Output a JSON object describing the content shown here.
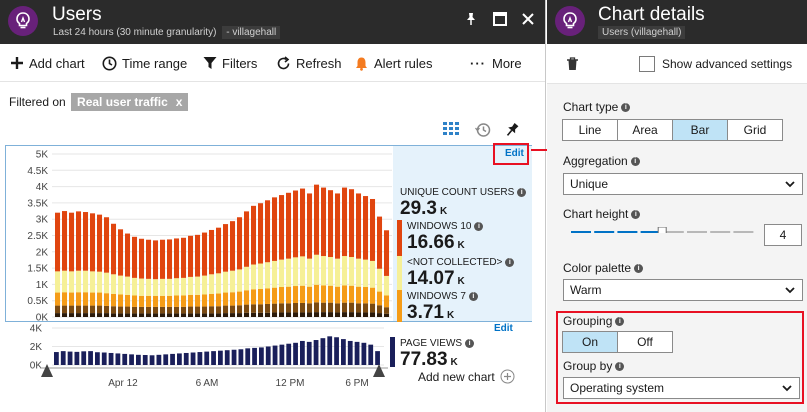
{
  "left_blade": {
    "title": "Users",
    "subtitle": "Last 24 hours (30 minute granularity)",
    "resource": "villagehall"
  },
  "toolbar": {
    "add_chart": "Add chart",
    "time_range": "Time range",
    "filters": "Filters",
    "refresh": "Refresh",
    "alert_rules": "Alert rules",
    "more": "More"
  },
  "filter": {
    "prefix": "Filtered on",
    "chip": "Real user traffic",
    "chip_close": "x"
  },
  "edit_label": "Edit",
  "main_chart_legend": {
    "total_label": "UNIQUE COUNT USERS",
    "total_value": "29.3",
    "total_unit": "K",
    "items": [
      {
        "label": "WINDOWS 10",
        "value": "16.66",
        "unit": "K",
        "color": "#e0450f"
      },
      {
        "label": "<NOT COLLECTED>",
        "value": "14.07",
        "unit": "K",
        "color": "#f6f097"
      },
      {
        "label": "WINDOWS 7",
        "value": "3.71",
        "unit": "K",
        "color": "#f59c17"
      }
    ]
  },
  "mini_chart_legend": {
    "label": "PAGE VIEWS",
    "value": "77.83",
    "unit": "K",
    "color": "#1a1f5a"
  },
  "add_new_chart": "Add new chart",
  "chart_data": [
    {
      "type": "bar",
      "stacked": true,
      "title": "",
      "ylim": [
        0,
        5000
      ],
      "y_tick_labels": [
        "5K",
        "4.5K",
        "4K",
        "3.5K",
        "3K",
        "2.5K",
        "2K",
        "1.5K",
        "1K",
        "0.5K",
        "0K"
      ],
      "series_order_bottom_to_top": [
        "dark base",
        "brown",
        "orange",
        "<NOT COLLECTED>",
        "WINDOWS 10"
      ],
      "series": [
        {
          "name": "WINDOWS 10",
          "color": "#e0450f",
          "values": [
            1800,
            1830,
            1800,
            1820,
            1800,
            1780,
            1750,
            1700,
            1550,
            1420,
            1320,
            1260,
            1220,
            1200,
            1190,
            1200,
            1210,
            1220,
            1230,
            1260,
            1280,
            1320,
            1360,
            1400,
            1460,
            1520,
            1600,
            1700,
            1800,
            1850,
            1900,
            1950,
            1980,
            2020,
            2050,
            2080,
            2000,
            2150,
            2100,
            2050,
            2000,
            2100,
            2080,
            2000,
            1950,
            1900,
            1600,
            1400
          ]
        },
        {
          "name": "<NOT COLLECTED>",
          "color": "#f6f097",
          "values": [
            650,
            660,
            650,
            660,
            660,
            650,
            640,
            630,
            600,
            580,
            560,
            540,
            530,
            520,
            510,
            520,
            520,
            530,
            540,
            550,
            560,
            580,
            600,
            620,
            640,
            660,
            680,
            720,
            760,
            780,
            800,
            820,
            840,
            860,
            880,
            900,
            860,
            920,
            900,
            880,
            860,
            900,
            880,
            860,
            840,
            820,
            700,
            600
          ]
        },
        {
          "name": "orange",
          "color": "#f59c17",
          "values": [
            400,
            410,
            400,
            410,
            410,
            400,
            400,
            390,
            380,
            370,
            360,
            350,
            340,
            340,
            340,
            340,
            340,
            350,
            350,
            360,
            360,
            370,
            380,
            390,
            400,
            410,
            420,
            440,
            460,
            470,
            480,
            490,
            500,
            510,
            520,
            530,
            510,
            540,
            530,
            520,
            510,
            530,
            520,
            510,
            500,
            490,
            420,
            360
          ]
        },
        {
          "name": "brown",
          "color": "#7a4a12",
          "values": [
            230,
            230,
            230,
            230,
            230,
            230,
            230,
            220,
            220,
            210,
            210,
            200,
            200,
            200,
            200,
            200,
            200,
            200,
            200,
            210,
            210,
            210,
            220,
            220,
            230,
            230,
            240,
            250,
            260,
            260,
            270,
            270,
            280,
            280,
            290,
            290,
            280,
            300,
            290,
            290,
            280,
            290,
            290,
            280,
            280,
            270,
            240,
            200
          ]
        },
        {
          "name": "dark base",
          "color": "#2b1a0a",
          "values": [
            120,
            120,
            120,
            120,
            120,
            120,
            120,
            120,
            110,
            110,
            110,
            110,
            110,
            110,
            110,
            110,
            110,
            110,
            110,
            110,
            110,
            110,
            110,
            110,
            120,
            120,
            120,
            130,
            130,
            130,
            130,
            140,
            140,
            140,
            140,
            140,
            140,
            150,
            150,
            150,
            140,
            150,
            150,
            140,
            140,
            140,
            120,
            100
          ]
        }
      ]
    },
    {
      "type": "bar",
      "title": "",
      "ylim": [
        0,
        4000
      ],
      "y_tick_labels": [
        "4K",
        "2K",
        "0K"
      ],
      "x_tick_labels": [
        "Apr 12",
        "6 AM",
        "12 PM",
        "6 PM"
      ],
      "series": [
        {
          "name": "PAGE VIEWS",
          "color": "#1a1f5a",
          "values": [
            1400,
            1500,
            1450,
            1420,
            1480,
            1500,
            1380,
            1350,
            1300,
            1250,
            1200,
            1150,
            1100,
            1080,
            1050,
            1100,
            1150,
            1200,
            1250,
            1300,
            1350,
            1400,
            1450,
            1500,
            1550,
            1600,
            1650,
            1700,
            1800,
            1850,
            1900,
            2000,
            2100,
            2200,
            2300,
            2400,
            2600,
            2500,
            2700,
            2900,
            3100,
            3000,
            2800,
            2600,
            2500,
            2400,
            2200,
            1500
          ]
        }
      ]
    }
  ],
  "right_blade": {
    "title": "Chart details",
    "subtitle": "Users (villagehall)",
    "show_advanced": "Show advanced settings",
    "chart_type_label": "Chart type",
    "chart_types": [
      "Line",
      "Area",
      "Bar",
      "Grid"
    ],
    "chart_type_selected": "Bar",
    "aggregation_label": "Aggregation",
    "aggregation_value": "Unique",
    "chart_height_label": "Chart height",
    "chart_height_value": "4",
    "chart_height_max": 8,
    "color_palette_label": "Color palette",
    "color_palette_value": "Warm",
    "grouping_label": "Grouping",
    "grouping_on": "On",
    "grouping_off": "Off",
    "grouping_selected": "On",
    "group_by_label": "Group by",
    "group_by_value": "Operating system"
  },
  "colors": {
    "header_bg": "#2b2b2b",
    "accent_blue": "#0072c6",
    "highlight_red": "#e81123",
    "app_icon_purple": "#68217a"
  }
}
